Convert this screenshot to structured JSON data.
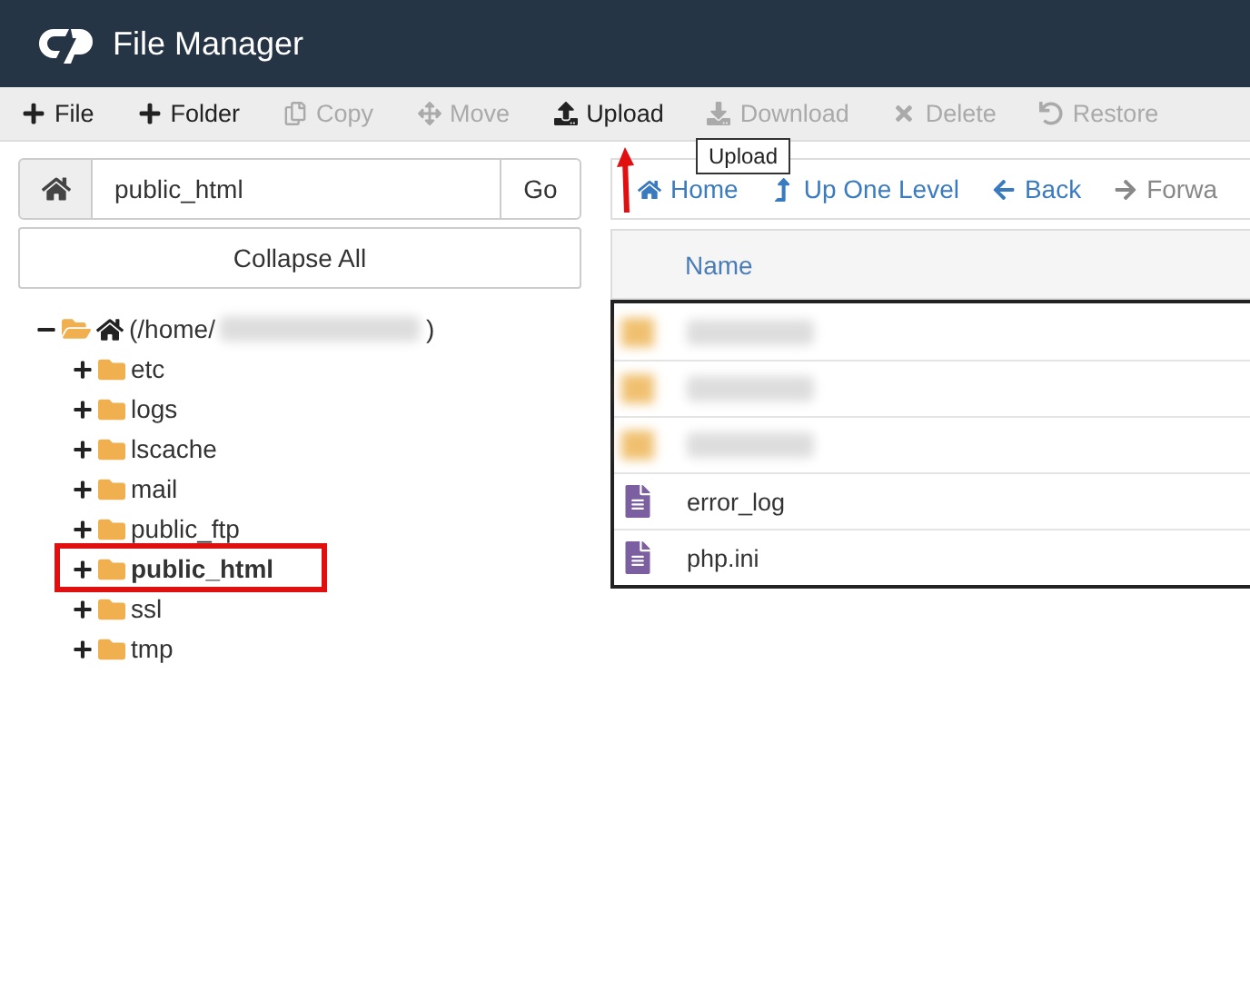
{
  "header": {
    "title": "File Manager"
  },
  "toolbar": [
    {
      "label": "File",
      "disabled": false
    },
    {
      "label": "Folder",
      "disabled": false
    },
    {
      "label": "Copy",
      "disabled": true
    },
    {
      "label": "Move",
      "disabled": true
    },
    {
      "label": "Upload",
      "disabled": false
    },
    {
      "label": "Download",
      "disabled": true
    },
    {
      "label": "Delete",
      "disabled": true
    },
    {
      "label": "Restore",
      "disabled": true
    }
  ],
  "tooltip": "Upload",
  "path_bar": {
    "value": "public_html",
    "go": "Go"
  },
  "collapse_all": "Collapse All",
  "tree": {
    "prefix": "(/home/",
    "suffix": ")",
    "expanded": true,
    "children": [
      {
        "name": "etc",
        "expanded": false,
        "selected": false
      },
      {
        "name": "logs",
        "expanded": false,
        "selected": false
      },
      {
        "name": "lscache",
        "expanded": false,
        "selected": false
      },
      {
        "name": "mail",
        "expanded": false,
        "selected": false
      },
      {
        "name": "public_ftp",
        "expanded": false,
        "selected": false
      },
      {
        "name": "public_html",
        "expanded": false,
        "selected": true
      },
      {
        "name": "ssl",
        "expanded": false,
        "selected": false
      },
      {
        "name": "tmp",
        "expanded": false,
        "selected": false
      }
    ]
  },
  "nav": [
    {
      "label": "Home",
      "disabled": false
    },
    {
      "label": "Up One Level",
      "disabled": false
    },
    {
      "label": "Back",
      "disabled": false
    },
    {
      "label": "Forwa",
      "disabled": true
    }
  ],
  "table": {
    "columns": [
      "Name"
    ],
    "rows": [
      {
        "kind": "blurred"
      },
      {
        "kind": "blurred"
      },
      {
        "kind": "blurred"
      },
      {
        "kind": "file",
        "name": "error_log"
      },
      {
        "kind": "file",
        "name": "php.ini"
      }
    ]
  }
}
